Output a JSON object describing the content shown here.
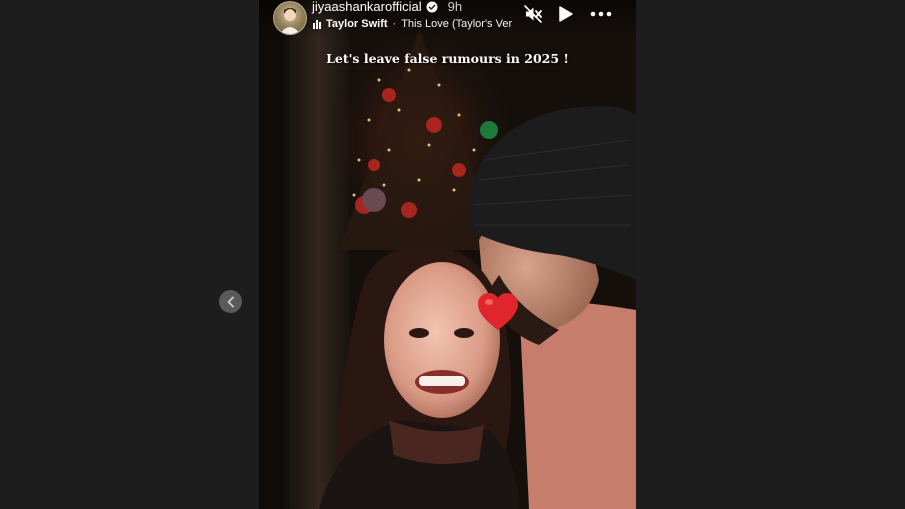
{
  "story": {
    "username": "jiyaashankarofficial",
    "time": "9h",
    "music": {
      "artist": "Taylor Swift",
      "separator": "·",
      "song": "This Love (Taylor's Ver"
    },
    "caption": "Let's leave false rumours in 2025 !"
  },
  "icons": {
    "prev": "chevron-left-icon",
    "verified": "verified-badge-icon",
    "music": "music-bars-icon",
    "mute": "speaker-muted-icon",
    "play": "play-icon",
    "more": "more-dots-icon",
    "heart": "heart-emoji"
  },
  "colors": {
    "page_background": "#1d1d1d",
    "prev_button": "#5a5a5a",
    "heart": "#e0262d",
    "sweater": "#c67d6c",
    "beanie": "#1c1c1c"
  }
}
